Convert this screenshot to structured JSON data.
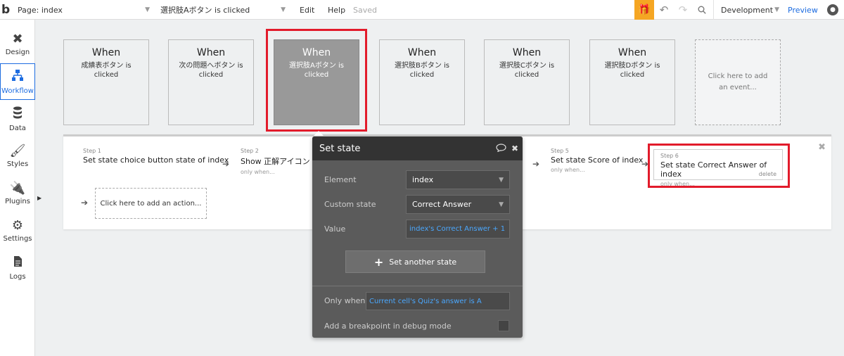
{
  "topbar": {
    "logo": "b",
    "page_selector": "Page: index",
    "event_selector": "選択肢Aボタン is clicked",
    "menu_edit": "Edit",
    "menu_help": "Help",
    "saved": "Saved",
    "environment": "Development",
    "preview": "Preview"
  },
  "sidebar": {
    "items": [
      {
        "label": "Design"
      },
      {
        "label": "Workflow"
      },
      {
        "label": "Data"
      },
      {
        "label": "Styles"
      },
      {
        "label": "Plugins"
      },
      {
        "label": "Settings"
      },
      {
        "label": "Logs"
      }
    ],
    "active": "Workflow"
  },
  "events": [
    {
      "when": "When",
      "desc": "成績表ボタン is clicked"
    },
    {
      "when": "When",
      "desc": "次の問題へボタン is clicked"
    },
    {
      "when": "When",
      "desc": "選択肢Aボタン is clicked"
    },
    {
      "when": "When",
      "desc": "選択肢Bボタン is clicked"
    },
    {
      "when": "When",
      "desc": "選択肢Cボタン is clicked"
    },
    {
      "when": "When",
      "desc": "選択肢Dボタン is clicked"
    }
  ],
  "add_event": "Click here to add an event...",
  "steps": [
    {
      "num": "Step 1",
      "title": "Set state choice button state of index",
      "only": ""
    },
    {
      "num": "Step 2",
      "title": "Show 正解アイコン",
      "only": "only when..."
    },
    {
      "num": "Step 5",
      "title": "Set state Score of index",
      "only": "only when..."
    },
    {
      "num": "Step 6",
      "title": "Set state Correct Answer of index",
      "only": "only when...",
      "delete": "delete"
    }
  ],
  "add_action": "Click here to add an action...",
  "dialog": {
    "title": "Set state",
    "element_label": "Element",
    "element_value": "index",
    "custom_state_label": "Custom state",
    "custom_state_value": "Correct Answer",
    "value_label": "Value",
    "value_expr": "index's Correct Answer + 1",
    "set_another": "Set another state",
    "only_when_label": "Only when",
    "only_when_expr": "Current cell's Quiz's answer is A",
    "breakpoint_label": "Add a breakpoint in debug mode"
  },
  "colors": {
    "accent": "#1d6ce0",
    "highlight": "#e21b2b",
    "gift": "#f5a623"
  }
}
